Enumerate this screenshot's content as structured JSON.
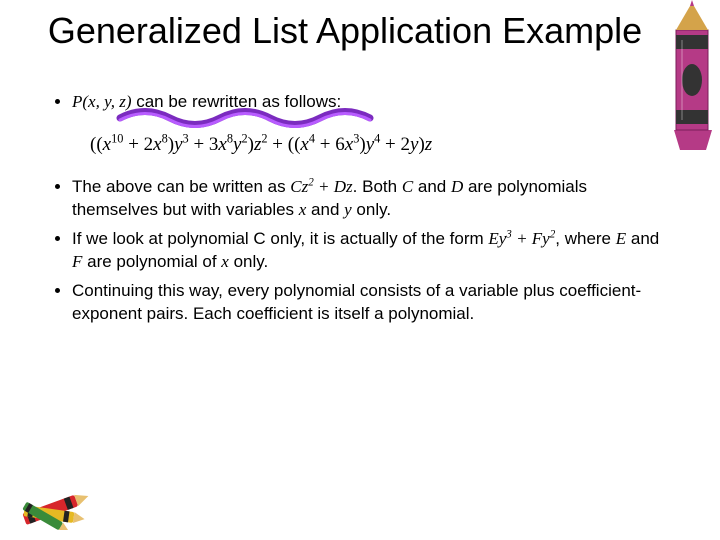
{
  "title": "Generalized List Application Example",
  "bullet1_prefix": "P(x, y, z)",
  "bullet1_rest": " can be rewritten as follows:",
  "formula_html": "((<i>x</i><sup>10</sup> + 2<i>x</i><sup>8</sup>)<i>y</i><sup>3</sup> + 3<i>x</i><sup>8</sup><i>y</i><sup>2</sup>)<i>z</i><sup>2</sup> + ((<i>x</i><sup>4</sup> + 6<i>x</i><sup>3</sup>)<i>y</i><sup>4</sup> + 2<i>y</i>)<i>z</i>",
  "bullet2_html": "The above can be written as <span class='italic'>Cz<sup>2</sup> + Dz</span>. Both <span class='italic'>C</span> and <span class='italic'>D</span> are polynomials themselves but with variables <span class='italic'>x</span> and <span class='italic'>y</span> only.",
  "bullet3_html": "If we look at polynomial C only, it is actually of the form <span class='italic'>Ey<sup>3</sup> + Fy<sup>2</sup></span>, where <span class='italic'>E</span> and <span class='italic'>F</span> are polynomial of <span class='italic'>x</span> only.",
  "bullet4": "Continuing this way, every polynomial consists of a variable plus coefficient-exponent pairs. Each coefficient is itself a polynomial."
}
